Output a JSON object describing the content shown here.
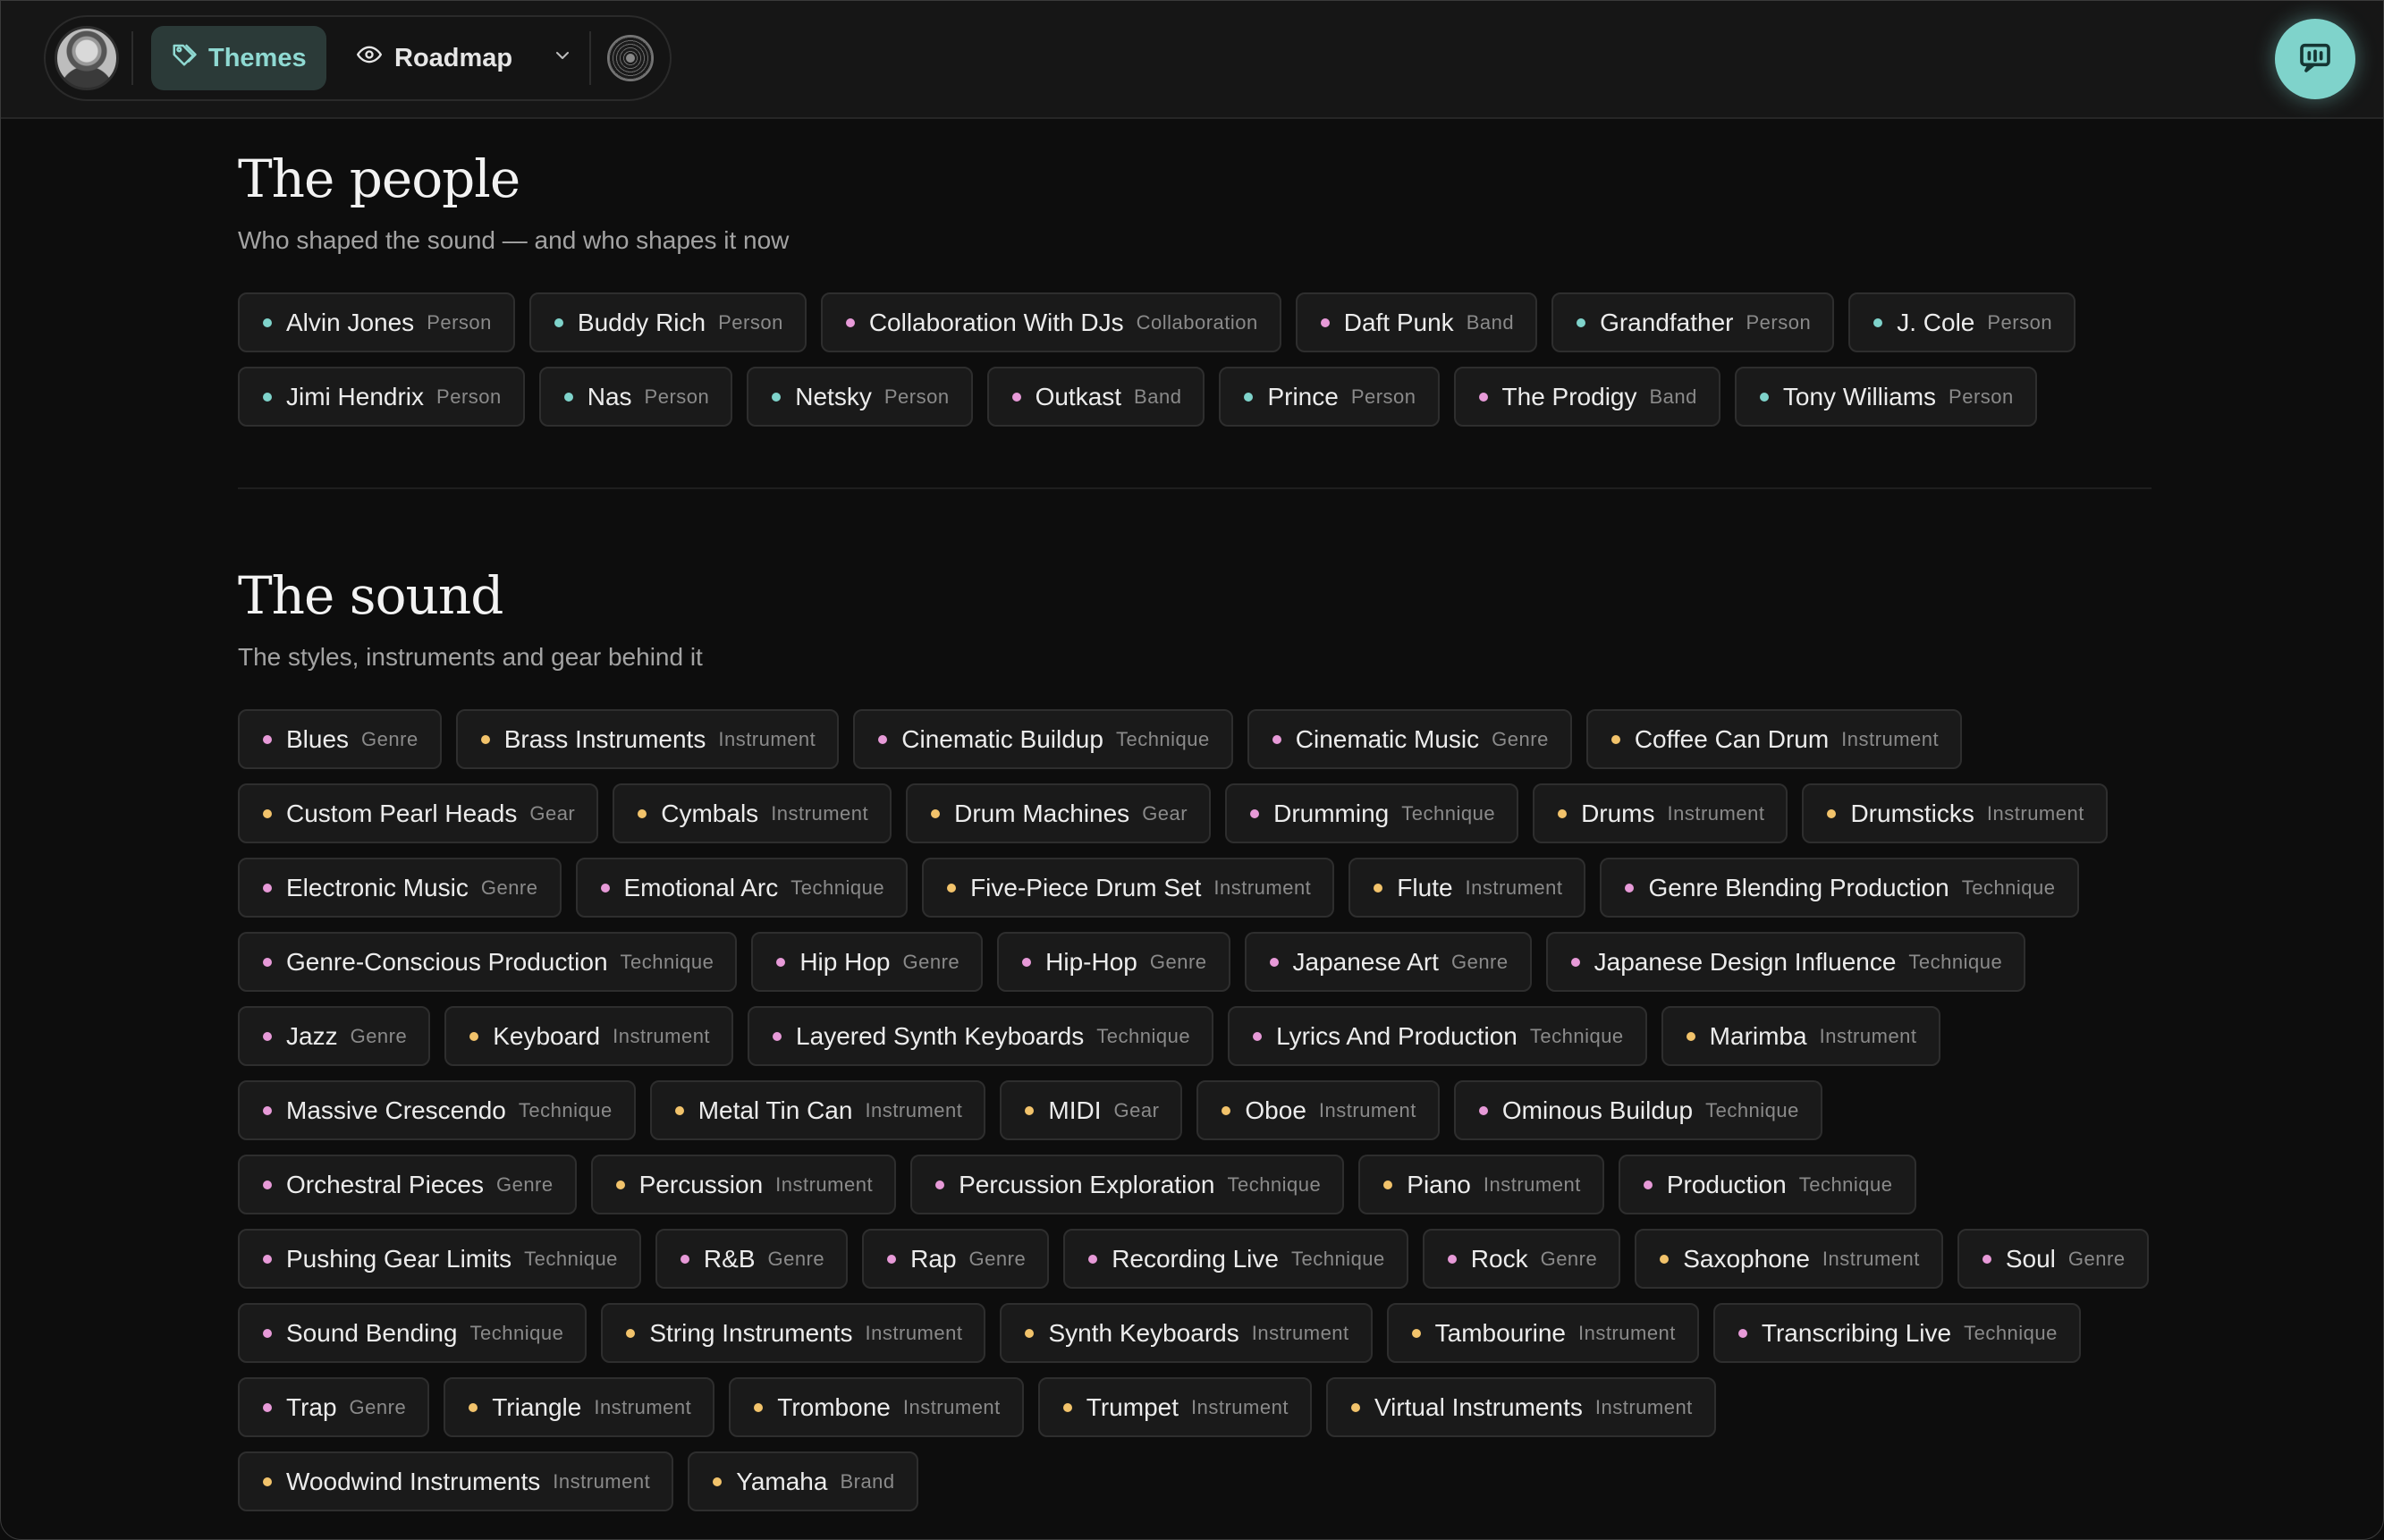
{
  "nav": {
    "themes_label": "Themes",
    "roadmap_label": "Roadmap"
  },
  "colors": {
    "accent": "#7fd3cb",
    "person_dot": "#7fd3cb",
    "band_dot": "#e79ad8",
    "genre_dot": "#e79ad8",
    "technique_dot": "#e79ad8",
    "instrument_dot": "#f2c36b",
    "gear_dot": "#f2c36b"
  },
  "people": {
    "title": "The people",
    "subtitle": "Who shaped the sound — and who shapes it now",
    "chips": [
      {
        "name": "Alvin Jones",
        "type": "Person",
        "dot": "#7fd3cb"
      },
      {
        "name": "Buddy Rich",
        "type": "Person",
        "dot": "#7fd3cb"
      },
      {
        "name": "Collaboration With DJs",
        "type": "Collaboration",
        "dot": "#e79ad8"
      },
      {
        "name": "Daft Punk",
        "type": "Band",
        "dot": "#e79ad8"
      },
      {
        "name": "Grandfather",
        "type": "Person",
        "dot": "#7fd3cb"
      },
      {
        "name": "J. Cole",
        "type": "Person",
        "dot": "#7fd3cb"
      },
      {
        "name": "Jimi Hendrix",
        "type": "Person",
        "dot": "#7fd3cb"
      },
      {
        "name": "Nas",
        "type": "Person",
        "dot": "#7fd3cb"
      },
      {
        "name": "Netsky",
        "type": "Person",
        "dot": "#7fd3cb"
      },
      {
        "name": "Outkast",
        "type": "Band",
        "dot": "#e79ad8"
      },
      {
        "name": "Prince",
        "type": "Person",
        "dot": "#7fd3cb"
      },
      {
        "name": "The Prodigy",
        "type": "Band",
        "dot": "#e79ad8"
      },
      {
        "name": "Tony Williams",
        "type": "Person",
        "dot": "#7fd3cb"
      }
    ]
  },
  "sound": {
    "title": "The sound",
    "subtitle": "The styles, instruments and gear behind it",
    "chips": [
      {
        "name": "Blues",
        "type": "Genre",
        "dot": "#e79ad8"
      },
      {
        "name": "Brass Instruments",
        "type": "Instrument",
        "dot": "#f2c36b"
      },
      {
        "name": "Cinematic Buildup",
        "type": "Technique",
        "dot": "#e79ad8"
      },
      {
        "name": "Cinematic Music",
        "type": "Genre",
        "dot": "#e79ad8"
      },
      {
        "name": "Coffee Can Drum",
        "type": "Instrument",
        "dot": "#f2c36b"
      },
      {
        "name": "Custom Pearl Heads",
        "type": "Gear",
        "dot": "#f2c36b"
      },
      {
        "name": "Cymbals",
        "type": "Instrument",
        "dot": "#f2c36b"
      },
      {
        "name": "Drum Machines",
        "type": "Gear",
        "dot": "#f2c36b"
      },
      {
        "name": "Drumming",
        "type": "Technique",
        "dot": "#e79ad8"
      },
      {
        "name": "Drums",
        "type": "Instrument",
        "dot": "#f2c36b"
      },
      {
        "name": "Drumsticks",
        "type": "Instrument",
        "dot": "#f2c36b"
      },
      {
        "name": "Electronic Music",
        "type": "Genre",
        "dot": "#e79ad8"
      },
      {
        "name": "Emotional Arc",
        "type": "Technique",
        "dot": "#e79ad8"
      },
      {
        "name": "Five-Piece Drum Set",
        "type": "Instrument",
        "dot": "#f2c36b"
      },
      {
        "name": "Flute",
        "type": "Instrument",
        "dot": "#f2c36b"
      },
      {
        "name": "Genre Blending Production",
        "type": "Technique",
        "dot": "#e79ad8"
      },
      {
        "name": "Genre-Conscious Production",
        "type": "Technique",
        "dot": "#e79ad8"
      },
      {
        "name": "Hip Hop",
        "type": "Genre",
        "dot": "#e79ad8"
      },
      {
        "name": "Hip-Hop",
        "type": "Genre",
        "dot": "#e79ad8"
      },
      {
        "name": "Japanese Art",
        "type": "Genre",
        "dot": "#e79ad8"
      },
      {
        "name": "Japanese Design Influence",
        "type": "Technique",
        "dot": "#e79ad8"
      },
      {
        "name": "Jazz",
        "type": "Genre",
        "dot": "#e79ad8"
      },
      {
        "name": "Keyboard",
        "type": "Instrument",
        "dot": "#f2c36b"
      },
      {
        "name": "Layered Synth Keyboards",
        "type": "Technique",
        "dot": "#e79ad8"
      },
      {
        "name": "Lyrics And Production",
        "type": "Technique",
        "dot": "#e79ad8"
      },
      {
        "name": "Marimba",
        "type": "Instrument",
        "dot": "#f2c36b"
      },
      {
        "name": "Massive Crescendo",
        "type": "Technique",
        "dot": "#e79ad8"
      },
      {
        "name": "Metal Tin Can",
        "type": "Instrument",
        "dot": "#f2c36b"
      },
      {
        "name": "MIDI",
        "type": "Gear",
        "dot": "#f2c36b"
      },
      {
        "name": "Oboe",
        "type": "Instrument",
        "dot": "#f2c36b"
      },
      {
        "name": "Ominous Buildup",
        "type": "Technique",
        "dot": "#e79ad8"
      },
      {
        "name": "Orchestral Pieces",
        "type": "Genre",
        "dot": "#e79ad8"
      },
      {
        "name": "Percussion",
        "type": "Instrument",
        "dot": "#f2c36b"
      },
      {
        "name": "Percussion Exploration",
        "type": "Technique",
        "dot": "#e79ad8"
      },
      {
        "name": "Piano",
        "type": "Instrument",
        "dot": "#f2c36b"
      },
      {
        "name": "Production",
        "type": "Technique",
        "dot": "#e79ad8"
      },
      {
        "name": "Pushing Gear Limits",
        "type": "Technique",
        "dot": "#e79ad8"
      },
      {
        "name": "R&B",
        "type": "Genre",
        "dot": "#e79ad8"
      },
      {
        "name": "Rap",
        "type": "Genre",
        "dot": "#e79ad8"
      },
      {
        "name": "Recording Live",
        "type": "Technique",
        "dot": "#e79ad8"
      },
      {
        "name": "Rock",
        "type": "Genre",
        "dot": "#e79ad8"
      },
      {
        "name": "Saxophone",
        "type": "Instrument",
        "dot": "#f2c36b"
      },
      {
        "name": "Soul",
        "type": "Genre",
        "dot": "#e79ad8"
      },
      {
        "name": "Sound Bending",
        "type": "Technique",
        "dot": "#e79ad8"
      },
      {
        "name": "String Instruments",
        "type": "Instrument",
        "dot": "#f2c36b"
      },
      {
        "name": "Synth Keyboards",
        "type": "Instrument",
        "dot": "#f2c36b"
      },
      {
        "name": "Tambourine",
        "type": "Instrument",
        "dot": "#f2c36b"
      },
      {
        "name": "Transcribing Live",
        "type": "Technique",
        "dot": "#e79ad8"
      },
      {
        "name": "Trap",
        "type": "Genre",
        "dot": "#e79ad8"
      },
      {
        "name": "Triangle",
        "type": "Instrument",
        "dot": "#f2c36b"
      },
      {
        "name": "Trombone",
        "type": "Instrument",
        "dot": "#f2c36b"
      },
      {
        "name": "Trumpet",
        "type": "Instrument",
        "dot": "#f2c36b"
      },
      {
        "name": "Virtual Instruments",
        "type": "Instrument",
        "dot": "#f2c36b"
      },
      {
        "name": "Woodwind Instruments",
        "type": "Instrument",
        "dot": "#f2c36b"
      },
      {
        "name": "Yamaha",
        "type": "Brand",
        "dot": "#f2c36b"
      }
    ]
  },
  "icons": {
    "themes": "tag-icon",
    "roadmap": "eye-icon",
    "dropdown": "chevron-down-icon",
    "record": "vinyl-icon",
    "chat": "chat-bubble-icon"
  }
}
